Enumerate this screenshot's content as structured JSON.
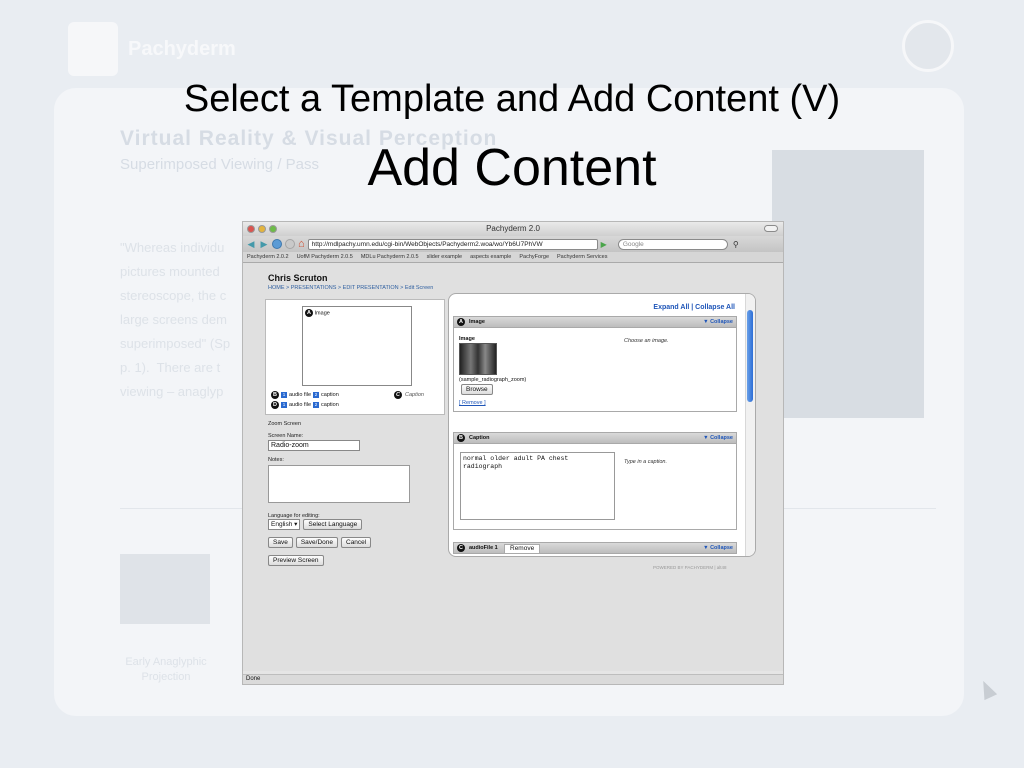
{
  "slide": {
    "title": "Select a Template and Add Content (V)",
    "subtitle": "Add Content"
  },
  "background": {
    "logo_text": "Pachyderm",
    "heading": "Virtual Reality & Visual Perception",
    "subheading": "Superimposed Viewing / Pass",
    "paragraph": "\"Whereas individu\npictures mounted\nstereoscope, the c\nlarge screens dem\nsuperimposed\" (Sp\np. 1).  There are t\nviewing – anaglyp",
    "thumb_caption": "Early Anaglyphic Projection"
  },
  "browser": {
    "window_title": "Pachyderm 2.0",
    "url": "http://mdlpachy.umn.edu/cgi-bin/WebObjects/Pachyderm2.woa/wo/Yb6U7PhVW",
    "search_placeholder": "Google",
    "status": "Done",
    "bookmarks": [
      "Pachyderm 2.0.2",
      "UofM Pachyderm 2.0.5",
      "MDLu Pachyderm 2.0.5",
      "slider example",
      "aspects example",
      "PachyForge",
      "Pachyderm Services"
    ]
  },
  "page": {
    "user": "Chris Scruton",
    "breadcrumb": "HOME > PRESENTATIONS > EDIT PRESENTATION > Edit Screen",
    "template": {
      "slot_a": "Image",
      "slot_c_label": "Caption",
      "row1_label1": "audio file",
      "row1_label2": "caption",
      "row2_label1": "audio file",
      "row2_label2": "caption"
    },
    "zoom_label": "Zoom Screen",
    "screen_name_label": "Screen Name:",
    "screen_name_value": "Radio-zoom",
    "notes_label": "Notes:",
    "language_label": "Language for editing:",
    "language_value": "English",
    "select_language": "Select Language",
    "save": "Save",
    "save_done": "Save/Done",
    "cancel": "Cancel",
    "preview": "Preview Screen",
    "expand_links": "Expand All | Collapse All",
    "collapse": "Collapse",
    "section_image": {
      "title": "Image",
      "field_label": "Image",
      "filename": "(sample_radiograph_zoom)",
      "browse": "Browse",
      "remove": "[ Remove ]",
      "hint": "Choose an image."
    },
    "section_caption": {
      "title": "Caption",
      "text": "normal older adult PA chest\nradiograph",
      "hint": "Type in a caption."
    },
    "section_audio": {
      "title": "audioFile 1",
      "remove": "Remove"
    },
    "powered_by": "POWERED BY PACHYDERM | alt48"
  }
}
